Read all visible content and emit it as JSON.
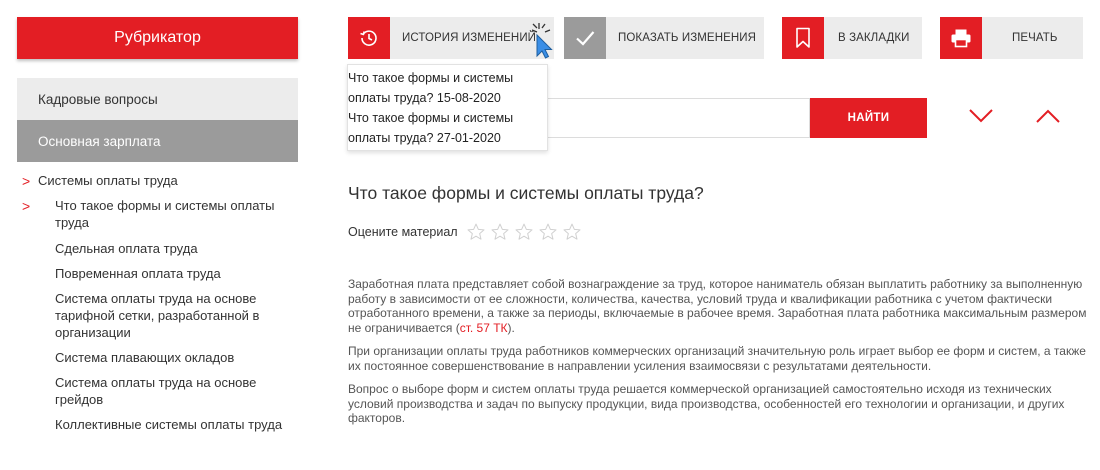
{
  "sidebar": {
    "rubricator_label": "Рубрикатор",
    "categories": [
      {
        "label": "Кадровые вопросы"
      },
      {
        "label": "Основная зарплата"
      }
    ],
    "tree": {
      "root": "Системы оплаты труда",
      "children": [
        {
          "label": "Что такое формы и системы оплаты труда",
          "active": true
        },
        {
          "label": "Сдельная оплата труда"
        },
        {
          "label": "Повременная оплата труда"
        },
        {
          "label": "Система оплаты труда на основе тарифной сетки, разработанной в организации"
        },
        {
          "label": "Система плавающих окладов"
        },
        {
          "label": "Система оплаты труда на основе грейдов"
        },
        {
          "label": "Коллективные системы оплаты труда"
        }
      ]
    }
  },
  "toolbar": {
    "history_label": "ИСТОРИЯ ИЗМЕНЕНИЙ",
    "show_changes_label": "ПОКАЗАТЬ ИЗМЕНЕНИЯ",
    "bookmark_label": "В ЗАКЛАДКИ",
    "print_label": "ПЕЧАТЬ"
  },
  "history_dropdown": {
    "items": [
      {
        "text": "Что такое формы и системы оплаты труда? 15-08-2020"
      },
      {
        "text": "Что такое формы и системы оплаты труда? 27-01-2020"
      }
    ]
  },
  "search": {
    "value": "",
    "button_label": "НАЙТИ"
  },
  "article": {
    "title": "Что такое формы и системы оплаты труда?",
    "rate_label": "Оцените материал",
    "rating": 0,
    "rating_max": 5,
    "p1_text": "Заработная плата представляет собой вознаграждение за труд, которое наниматель обязан выплатить работнику за выполненную работу в зависимости от ее сложности, количества, качества, условий труда и квалификации работника с учетом фактически отработанного времени, а также за периоды, включаемые в рабочее время. Заработная плата работника максимальным размером не ограничивается (",
    "p1_link": "ст. 57 ТК",
    "p1_end": ").",
    "p2": "При организации оплаты труда работников коммерческих организаций значительную роль играет выбор ее форм и систем, а также их постоянное совершенствование в направлении усиления взаимосвязи с результатами деятельности.",
    "p3": "Вопрос о выборе форм и систем оплаты труда решается коммерческой организацией самостоятельно исходя из технических условий производства и задач по выпуску продукции, вида производства, особенностей его технологии и организации, и других факторов."
  },
  "colors": {
    "accent": "#e31e24",
    "toolbar_bg": "#ececec",
    "category_active_bg": "#9b9b9b"
  },
  "icons": {
    "history": "history-clock-icon",
    "show_changes": "checkmark-icon",
    "bookmark": "bookmark-icon",
    "print": "printer-icon",
    "nav_down": "chevron-down-icon",
    "nav_up": "chevron-up-icon",
    "star": "star-outline-icon",
    "tree_marker": "chevron-right-icon"
  }
}
